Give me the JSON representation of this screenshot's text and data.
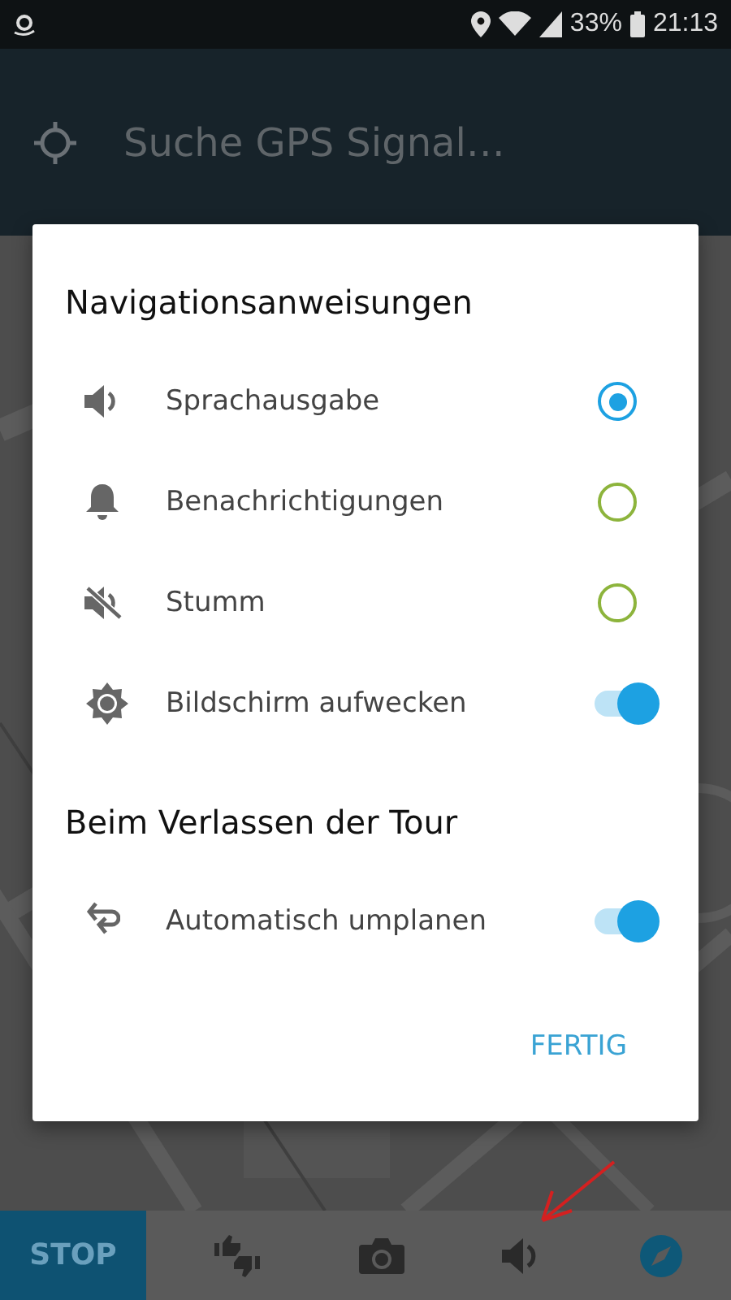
{
  "status_bar": {
    "battery": "33%",
    "time": "21:13"
  },
  "app_bar": {
    "title": "Suche GPS Signal…"
  },
  "dialog": {
    "sections": [
      {
        "title": "Navigationsanweisungen",
        "items": [
          {
            "kind": "radio",
            "label": "Sprachausgabe",
            "selected": true
          },
          {
            "kind": "radio",
            "label": "Benachrichtigungen",
            "selected": false
          },
          {
            "kind": "radio",
            "label": "Stumm",
            "selected": false
          },
          {
            "kind": "toggle",
            "label": "Bildschirm aufwecken",
            "on": true
          }
        ]
      },
      {
        "title": "Beim Verlassen der Tour",
        "items": [
          {
            "kind": "toggle",
            "label": "Automatisch umplanen",
            "on": true
          }
        ]
      }
    ],
    "button": "FERTIG"
  },
  "bottom_bar": {
    "stop": "STOP"
  }
}
